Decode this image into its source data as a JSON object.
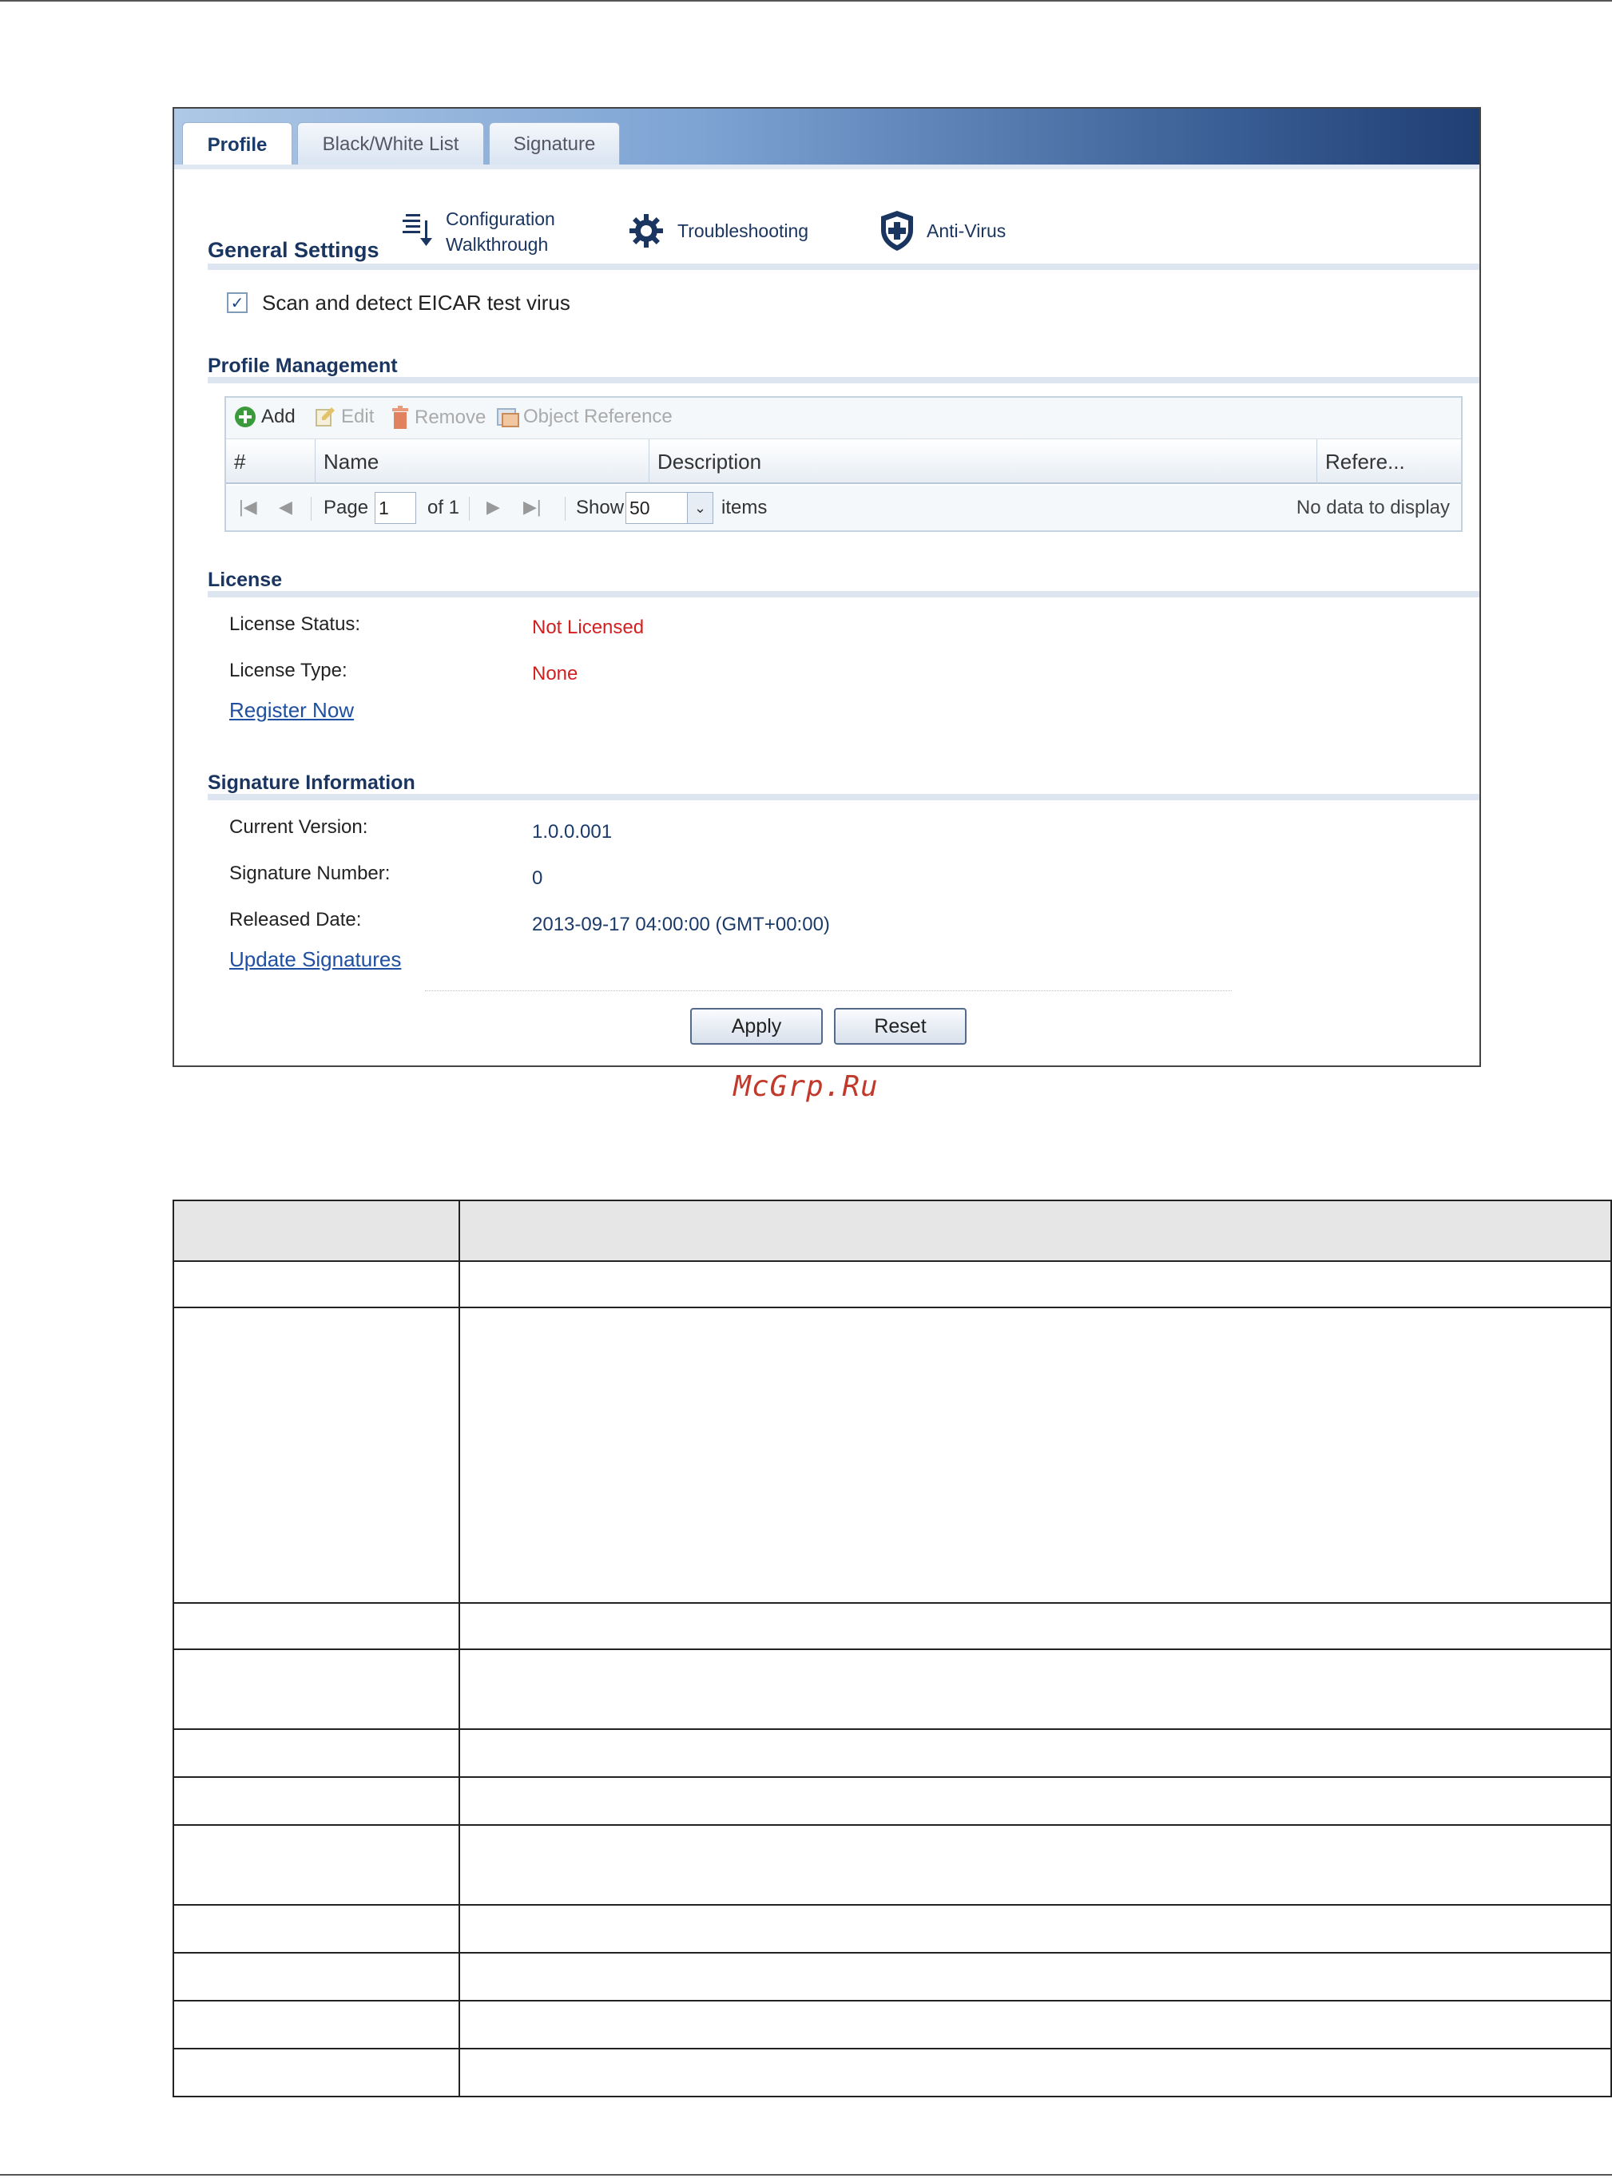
{
  "tabs": [
    {
      "label": "Profile",
      "active": true
    },
    {
      "label": "Black/White List",
      "active": false
    },
    {
      "label": "Signature",
      "active": false
    }
  ],
  "general_settings": {
    "title": "General Settings",
    "config_walkthrough_line1": "Configuration",
    "config_walkthrough_line2": "Walkthrough",
    "troubleshooting": "Troubleshooting",
    "anti_virus": "Anti-Virus",
    "scan_eicar_label": "Scan and detect EICAR test virus",
    "scan_eicar_checked": true
  },
  "profile_management": {
    "title": "Profile Management",
    "toolbar": {
      "add": "Add",
      "edit": "Edit",
      "remove": "Remove",
      "object_reference": "Object Reference"
    },
    "columns": [
      "#",
      "Name",
      "Description",
      "Refere..."
    ],
    "pager": {
      "page_label": "Page",
      "page_value": "1",
      "of_label": "of 1",
      "show_label": "Show",
      "show_value": "50",
      "items_label": "items",
      "no_data": "No data to display"
    }
  },
  "license": {
    "title": "License",
    "status_label": "License Status:",
    "status_value": "Not Licensed",
    "type_label": "License Type:",
    "type_value": "None",
    "register_link": "Register Now"
  },
  "signature_info": {
    "title": "Signature Information",
    "current_version_label": "Current Version:",
    "current_version_value": "1.0.0.001",
    "signature_number_label": "Signature Number:",
    "signature_number_value": "0",
    "released_date_label": "Released Date:",
    "released_date_value": "2013-09-17 04:00:00 (GMT+00:00)",
    "update_link": "Update Signatures"
  },
  "buttons": {
    "apply": "Apply",
    "reset": "Reset"
  },
  "watermark": "McGrp.Ru",
  "colors": {
    "not_licensed": "#d21f1f",
    "link": "#1f4fa0",
    "section_title": "#1a3560"
  }
}
